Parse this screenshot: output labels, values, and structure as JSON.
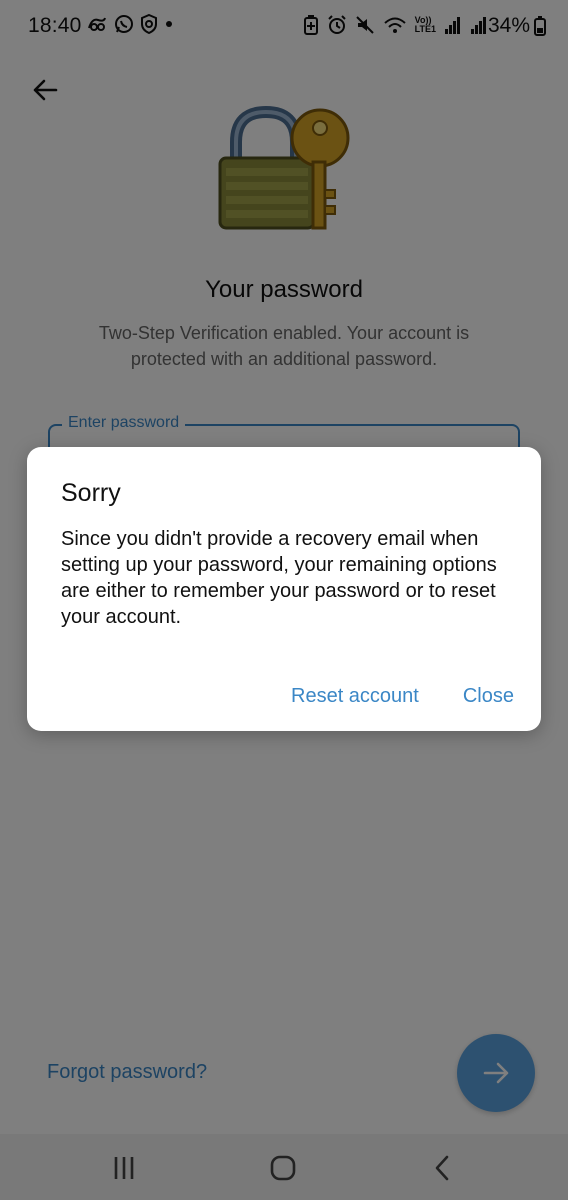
{
  "status_bar": {
    "time": "18:40",
    "battery": "34%",
    "network_label_top": "Vo))",
    "network_label_bottom": "LTE1",
    "left_icons": [
      "notification-icon",
      "whatsapp-icon",
      "shield-icon",
      "dot-icon"
    ],
    "right_icons": [
      "battery-saver-icon",
      "alarm-icon",
      "mute-icon",
      "wifi-icon",
      "volte-icon",
      "signal-icon",
      "signal-icon",
      "battery-icon"
    ]
  },
  "screen": {
    "back_icon": "arrow-left-icon",
    "illustration": "lock-and-key-icon",
    "title": "Your password",
    "subtitle": "Two-Step Verification enabled. Your account is protected with an additional password.",
    "password_field": {
      "label": "Enter password",
      "value": ""
    },
    "forgot_password_label": "Forgot password?",
    "next_icon": "arrow-right-icon"
  },
  "dialog": {
    "title": "Sorry",
    "message": "Since you didn't provide a recovery email when setting up your password, your remaining options are either to remember your password or to reset your account.",
    "reset_label": "Reset account",
    "close_label": "Close"
  },
  "nav_bar": {
    "icons": [
      "recent-apps-icon",
      "home-icon",
      "back-icon"
    ]
  },
  "colors": {
    "accent": "#3b87c6",
    "fab": "#5aa2e0",
    "scrim": "rgba(0,0,0,0.5)"
  }
}
